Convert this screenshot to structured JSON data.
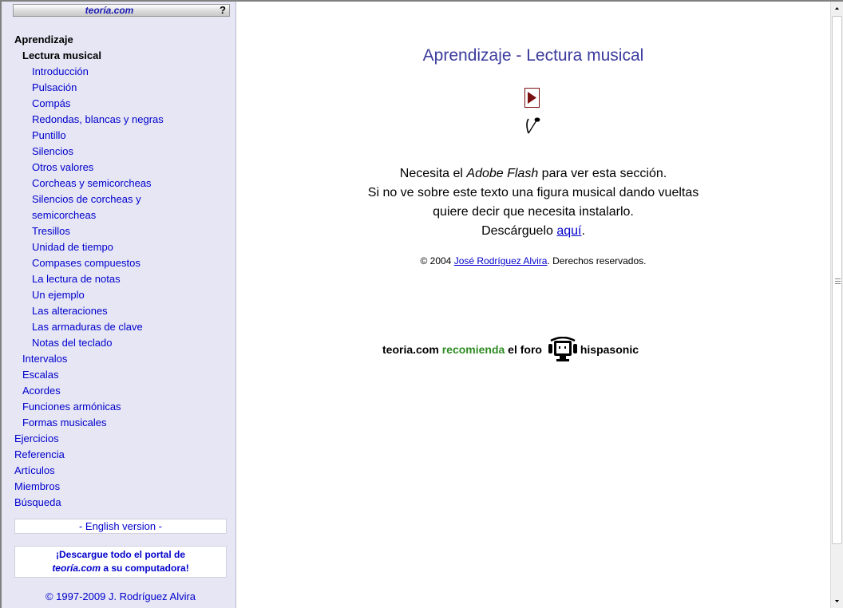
{
  "sidebar": {
    "site_name": "teoría.com",
    "help_label": "?",
    "nav": [
      {
        "label": "Aprendizaje"
      },
      {
        "label": "Lectura musical"
      },
      {
        "label": "Introducción"
      },
      {
        "label": "Pulsación"
      },
      {
        "label": "Compás"
      },
      {
        "label": "Redondas, blancas y negras"
      },
      {
        "label": "Puntillo"
      },
      {
        "label": "Silencios"
      },
      {
        "label": "Otros valores"
      },
      {
        "label": "Corcheas y semicorcheas"
      },
      {
        "label": "Silencios de corcheas y"
      },
      {
        "label": "semicorcheas"
      },
      {
        "label": "Tresillos"
      },
      {
        "label": "Unidad de tiempo"
      },
      {
        "label": "Compases compuestos"
      },
      {
        "label": "La lectura de notas"
      },
      {
        "label": "Un ejemplo"
      },
      {
        "label": "Las alteraciones"
      },
      {
        "label": "Las armaduras de clave"
      },
      {
        "label": "Notas del teclado"
      },
      {
        "label": "Intervalos"
      },
      {
        "label": "Escalas"
      },
      {
        "label": "Acordes"
      },
      {
        "label": "Funciones armónicas"
      },
      {
        "label": "Formas musicales"
      },
      {
        "label": "Ejercicios"
      },
      {
        "label": "Referencia"
      },
      {
        "label": "Artículos"
      },
      {
        "label": "Miembros"
      },
      {
        "label": "Búsqueda"
      }
    ],
    "english_version": "- English version -",
    "download_line1": "¡Descargue todo el portal de",
    "download_line2_italic": "teoría.com",
    "download_line2_rest": " a su computadora!",
    "copyright": "© 1997-2009 J. Rodríguez Alvira"
  },
  "main": {
    "title": "Aprendizaje - Lectura musical",
    "flash_line1_a": "Necesita el ",
    "flash_line1_italic": "Adobe Flash",
    "flash_line1_b": " para ver esta sección.",
    "flash_line2": "Si no ve sobre este texto una figura musical dando vueltas",
    "flash_line3": "quiere decir que necesita instalarlo.",
    "flash_line4_a": "Descárguelo ",
    "flash_line4_link": "aquí",
    "flash_line4_b": ".",
    "copyright_a": "© 2004 ",
    "copyright_link": "José Rodríguez Alvira",
    "copyright_b": ".  Derechos reservados.",
    "promo_a": "teoria.com ",
    "promo_green": "recomienda",
    "promo_b": " el foro ",
    "promo_c": "hispasonic"
  },
  "colors": {
    "sidebar_bg": "#e6e6f5",
    "link": "#0000cc",
    "title": "#3b3b9e",
    "recommend_green": "#2e8b22",
    "play_border": "#7a1010"
  },
  "icons": {
    "play": "play-icon",
    "note": "eighth-note-icon",
    "monitor": "monitor-logo-icon",
    "scroll_up": "chevron-up-icon",
    "scroll_down": "chevron-down-icon"
  }
}
